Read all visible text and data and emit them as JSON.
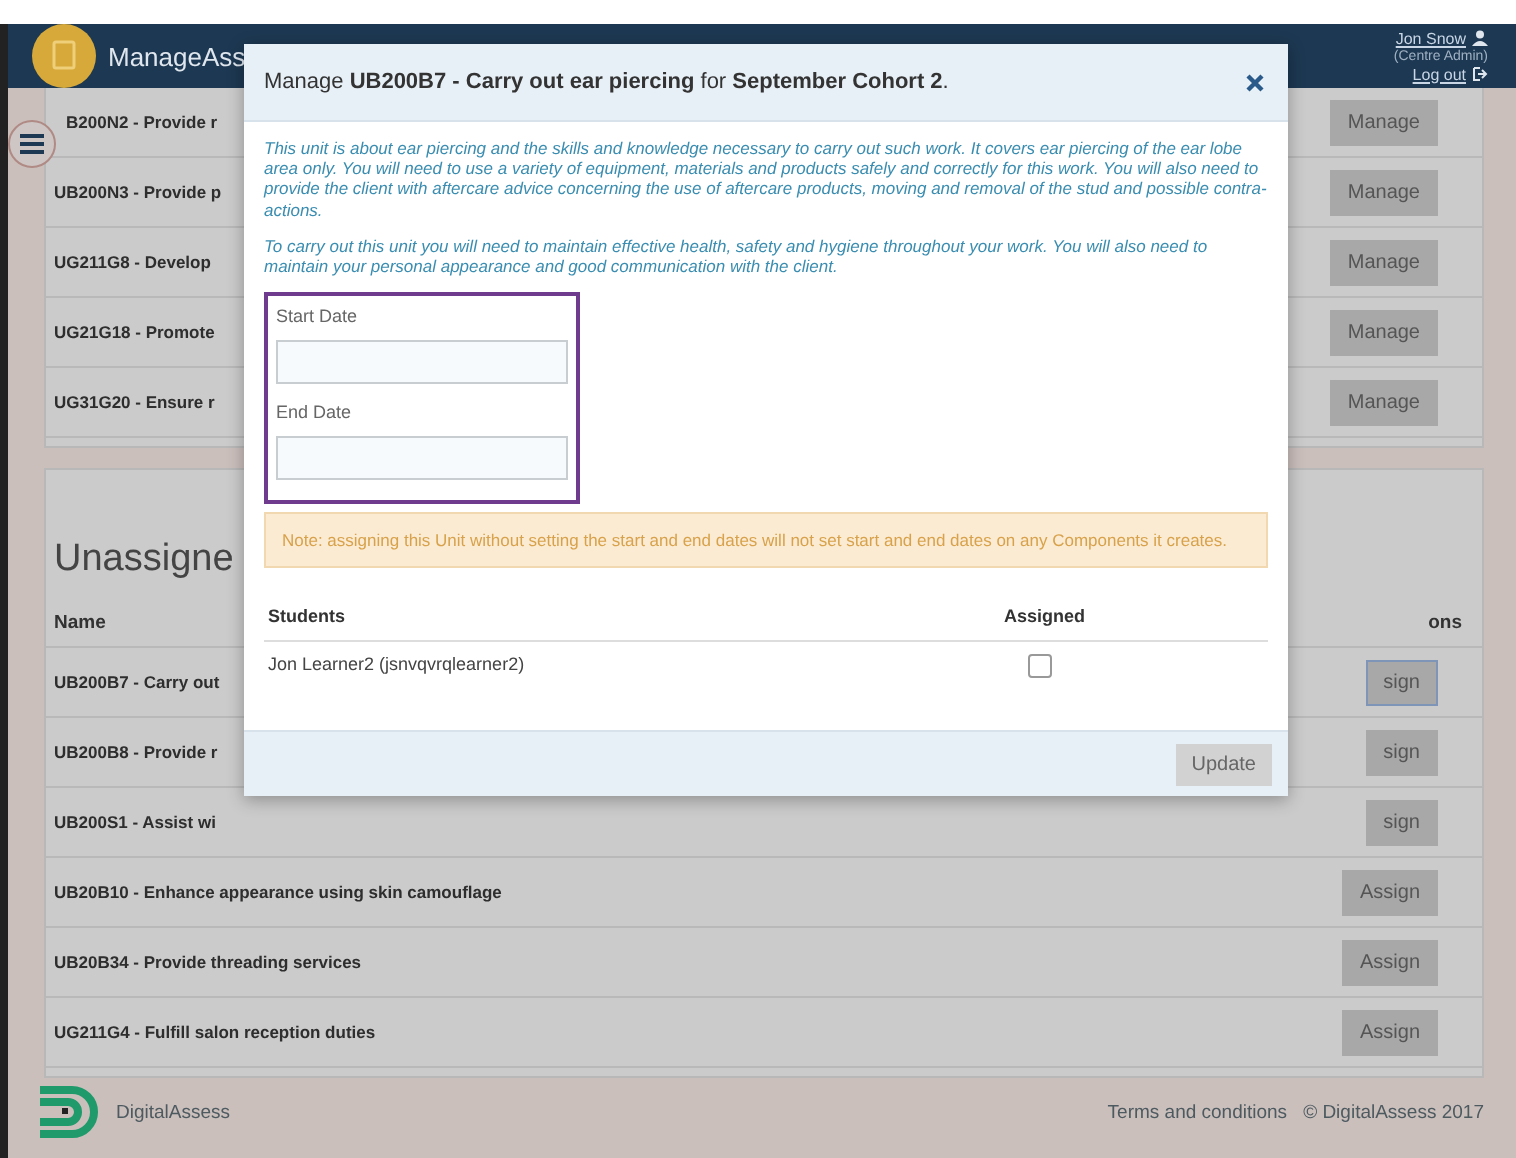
{
  "header": {
    "app_name": "ManageAss",
    "user_name": "Jon Snow",
    "user_role": "(Centre Admin)",
    "logout": "Log out"
  },
  "assigned_units": [
    {
      "name": "B200N2 - Provide r",
      "action": "Manage"
    },
    {
      "name": "UB200N3 - Provide p",
      "action": "Manage"
    },
    {
      "name": "UG211G8 - Develop",
      "action": "Manage"
    },
    {
      "name": "UG21G18 - Promote",
      "action": "Manage"
    },
    {
      "name": "UG31G20 - Ensure r",
      "action": "Manage"
    }
  ],
  "unassigned": {
    "heading": "Unassigne",
    "columns": [
      "Name",
      "ons"
    ],
    "rows": [
      {
        "name": "UB200B7 - Carry out",
        "action": "sign",
        "focused": true
      },
      {
        "name": "UB200B8 - Provide r",
        "action": "sign",
        "focused": false
      },
      {
        "name": "UB200S1 - Assist wi",
        "action": "sign",
        "focused": false
      },
      {
        "name": "UB20B10 - Enhance appearance using skin camouflage",
        "action": "Assign",
        "focused": false
      },
      {
        "name": "UB20B34 - Provide threading services",
        "action": "Assign",
        "focused": false
      },
      {
        "name": "UG211G4 - Fulfill salon reception duties",
        "action": "Assign",
        "focused": false
      }
    ]
  },
  "modal": {
    "title": "Manage **UB200B7 - Carry out ear piercing** for **September Cohort 2**.",
    "description": [
      "This unit is about ear piercing and the skills and knowledge necessary to carry out such work. It covers ear piercing of the ear lobe area only. You will need to use a variety of equipment, materials and products safely and correctly for this work. You will also need to provide the client with aftercare advice concerning the use of aftercare products, moving and removal of the stud and possible contra-actions.",
      "To carry out this unit you will need to maintain effective health, safety and hygiene throughout your work. You will also need to maintain your personal appearance and good communication with the client."
    ],
    "start_label": "Start Date",
    "end_label": "End Date",
    "note": "Note: assigning this Unit without setting the start and end dates will not set start and end dates on any Components it creates.",
    "columns": [
      "Students",
      "Assigned"
    ],
    "students": [
      {
        "name": "Jon Learner2 (jsnvqvrqlearner2)",
        "checked": false
      }
    ],
    "button": "Update"
  },
  "footer": {
    "brand": "DigitalAssess",
    "terms": "Terms and conditions",
    "copyright": "© DigitalAssess 2017"
  }
}
